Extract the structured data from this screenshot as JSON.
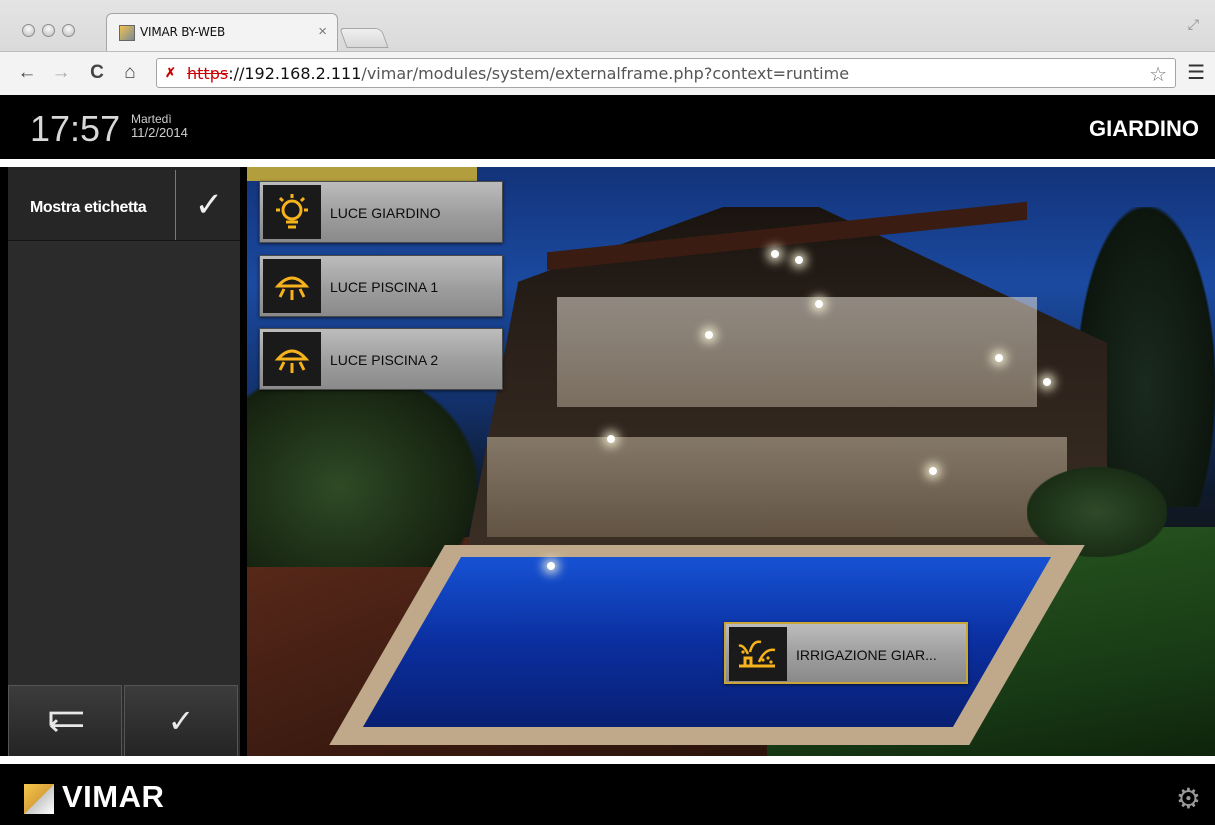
{
  "browser": {
    "tab_title": "VIMAR BY-WEB",
    "tab_close": "×",
    "url_scheme": "https",
    "url_host": "://192.168.2.111",
    "url_path": "/vimar/modules/system/externalframe.php?context=runtime"
  },
  "header": {
    "time": "17:57",
    "day": "Martedì",
    "date": "11/2/2014",
    "room": "GIARDINO"
  },
  "sidebar": {
    "label": "Mostra etichetta",
    "check_icon": "checkmark-icon",
    "back_button": "back-icon",
    "confirm_button": "checkmark-icon"
  },
  "widgets": [
    {
      "label": "LUCE GIARDINO",
      "icon": "bulb-on-icon"
    },
    {
      "label": "LUCE PISCINA 1",
      "icon": "spotlight-icon"
    },
    {
      "label": "LUCE PISCINA 2",
      "icon": "spotlight-icon"
    },
    {
      "label": "IRRIGAZIONE GIAR...",
      "icon": "irrigation-icon"
    }
  ],
  "footer": {
    "brand": "VIMAR",
    "settings_icon": "gear-icon"
  },
  "colors": {
    "accent": "#f6b31c",
    "selected_border": "#caa638",
    "panel": "#2b2b2b"
  }
}
